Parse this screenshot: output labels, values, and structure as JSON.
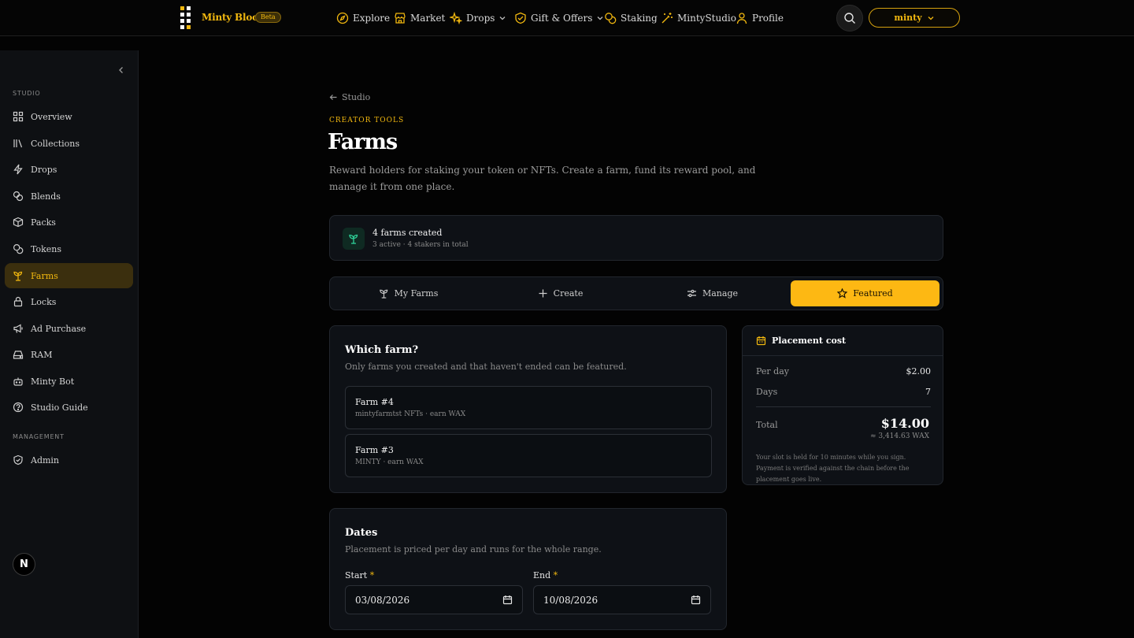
{
  "brand": {
    "name": "Minty Blocks",
    "badge": "Beta"
  },
  "nav": [
    {
      "label": "Explore",
      "icon": "compass-icon"
    },
    {
      "label": "Market",
      "icon": "store-icon"
    },
    {
      "label": "Drops",
      "icon": "sparkles-icon",
      "dropdown": true
    },
    {
      "label": "Gift & Offers",
      "icon": "gift-shield-icon",
      "dropdown": true
    },
    {
      "label": "Staking",
      "icon": "coins-icon"
    },
    {
      "label": "MintyStudio",
      "icon": "magic-wand-icon"
    },
    {
      "label": "Profile",
      "icon": "user-icon"
    }
  ],
  "account": {
    "label": "minty"
  },
  "sidebar": {
    "section_studio": "STUDIO",
    "section_management": "MANAGEMENT",
    "items": [
      {
        "label": "Overview",
        "icon": "grid-icon"
      },
      {
        "label": "Collections",
        "icon": "library-icon"
      },
      {
        "label": "Drops",
        "icon": "lightning-icon"
      },
      {
        "label": "Blends",
        "icon": "blend-icon"
      },
      {
        "label": "Packs",
        "icon": "box-icon"
      },
      {
        "label": "Tokens",
        "icon": "coins-icon"
      },
      {
        "label": "Farms",
        "icon": "sprout-icon",
        "active": true
      },
      {
        "label": "Locks",
        "icon": "lock-icon"
      },
      {
        "label": "Ad Purchase",
        "icon": "megaphone-icon"
      },
      {
        "label": "RAM",
        "icon": "hard-drive-icon"
      },
      {
        "label": "Minty Bot",
        "icon": "bot-icon"
      },
      {
        "label": "Studio Guide",
        "icon": "help-circle-icon"
      }
    ],
    "admin": {
      "label": "Admin",
      "icon": "shield-check-icon"
    },
    "footer_badge": "N"
  },
  "main": {
    "back": "Studio",
    "eyebrow": "CREATOR TOOLS",
    "title": "Farms",
    "description": "Reward holders for staking your token or NFTs. Create a farm, fund its reward pool, and manage it from one place.",
    "stats": {
      "title": "4 farms created",
      "subtitle": "3 active · 4 stakers in total"
    },
    "tabs": [
      {
        "label": "My Farms",
        "icon": "sprout-icon"
      },
      {
        "label": "Create",
        "icon": "plus-icon"
      },
      {
        "label": "Manage",
        "icon": "sliders-icon"
      },
      {
        "label": "Featured",
        "icon": "star-icon",
        "active": true
      }
    ],
    "which_farm": {
      "title": "Which farm?",
      "subtitle": "Only farms you created and that haven't ended can be featured.",
      "options": [
        {
          "name": "Farm #4",
          "meta": "mintyfarmtst NFTs · earn WAX"
        },
        {
          "name": "Farm #3",
          "meta": "MINTY · earn WAX"
        }
      ]
    },
    "placement_cost": {
      "title": "Placement cost",
      "per_day_label": "Per day",
      "per_day_value": "$2.00",
      "days_label": "Days",
      "days_value": "7",
      "total_label": "Total",
      "total_value": "$14.00",
      "total_wax": "≈ 3,414.63 WAX",
      "note": "Your slot is held for 10 minutes while you sign. Payment is verified against the chain before the placement goes live."
    },
    "dates": {
      "title": "Dates",
      "subtitle": "Placement is priced per day and runs for the whole range.",
      "start_label": "Start",
      "start_value": "03/08/2026",
      "end_label": "End",
      "end_value": "10/08/2026",
      "required_mark": "*"
    }
  },
  "colors": {
    "accent": "#fdb813",
    "background": "#030303",
    "card": "#0e1116",
    "green": "#2fd39a"
  }
}
